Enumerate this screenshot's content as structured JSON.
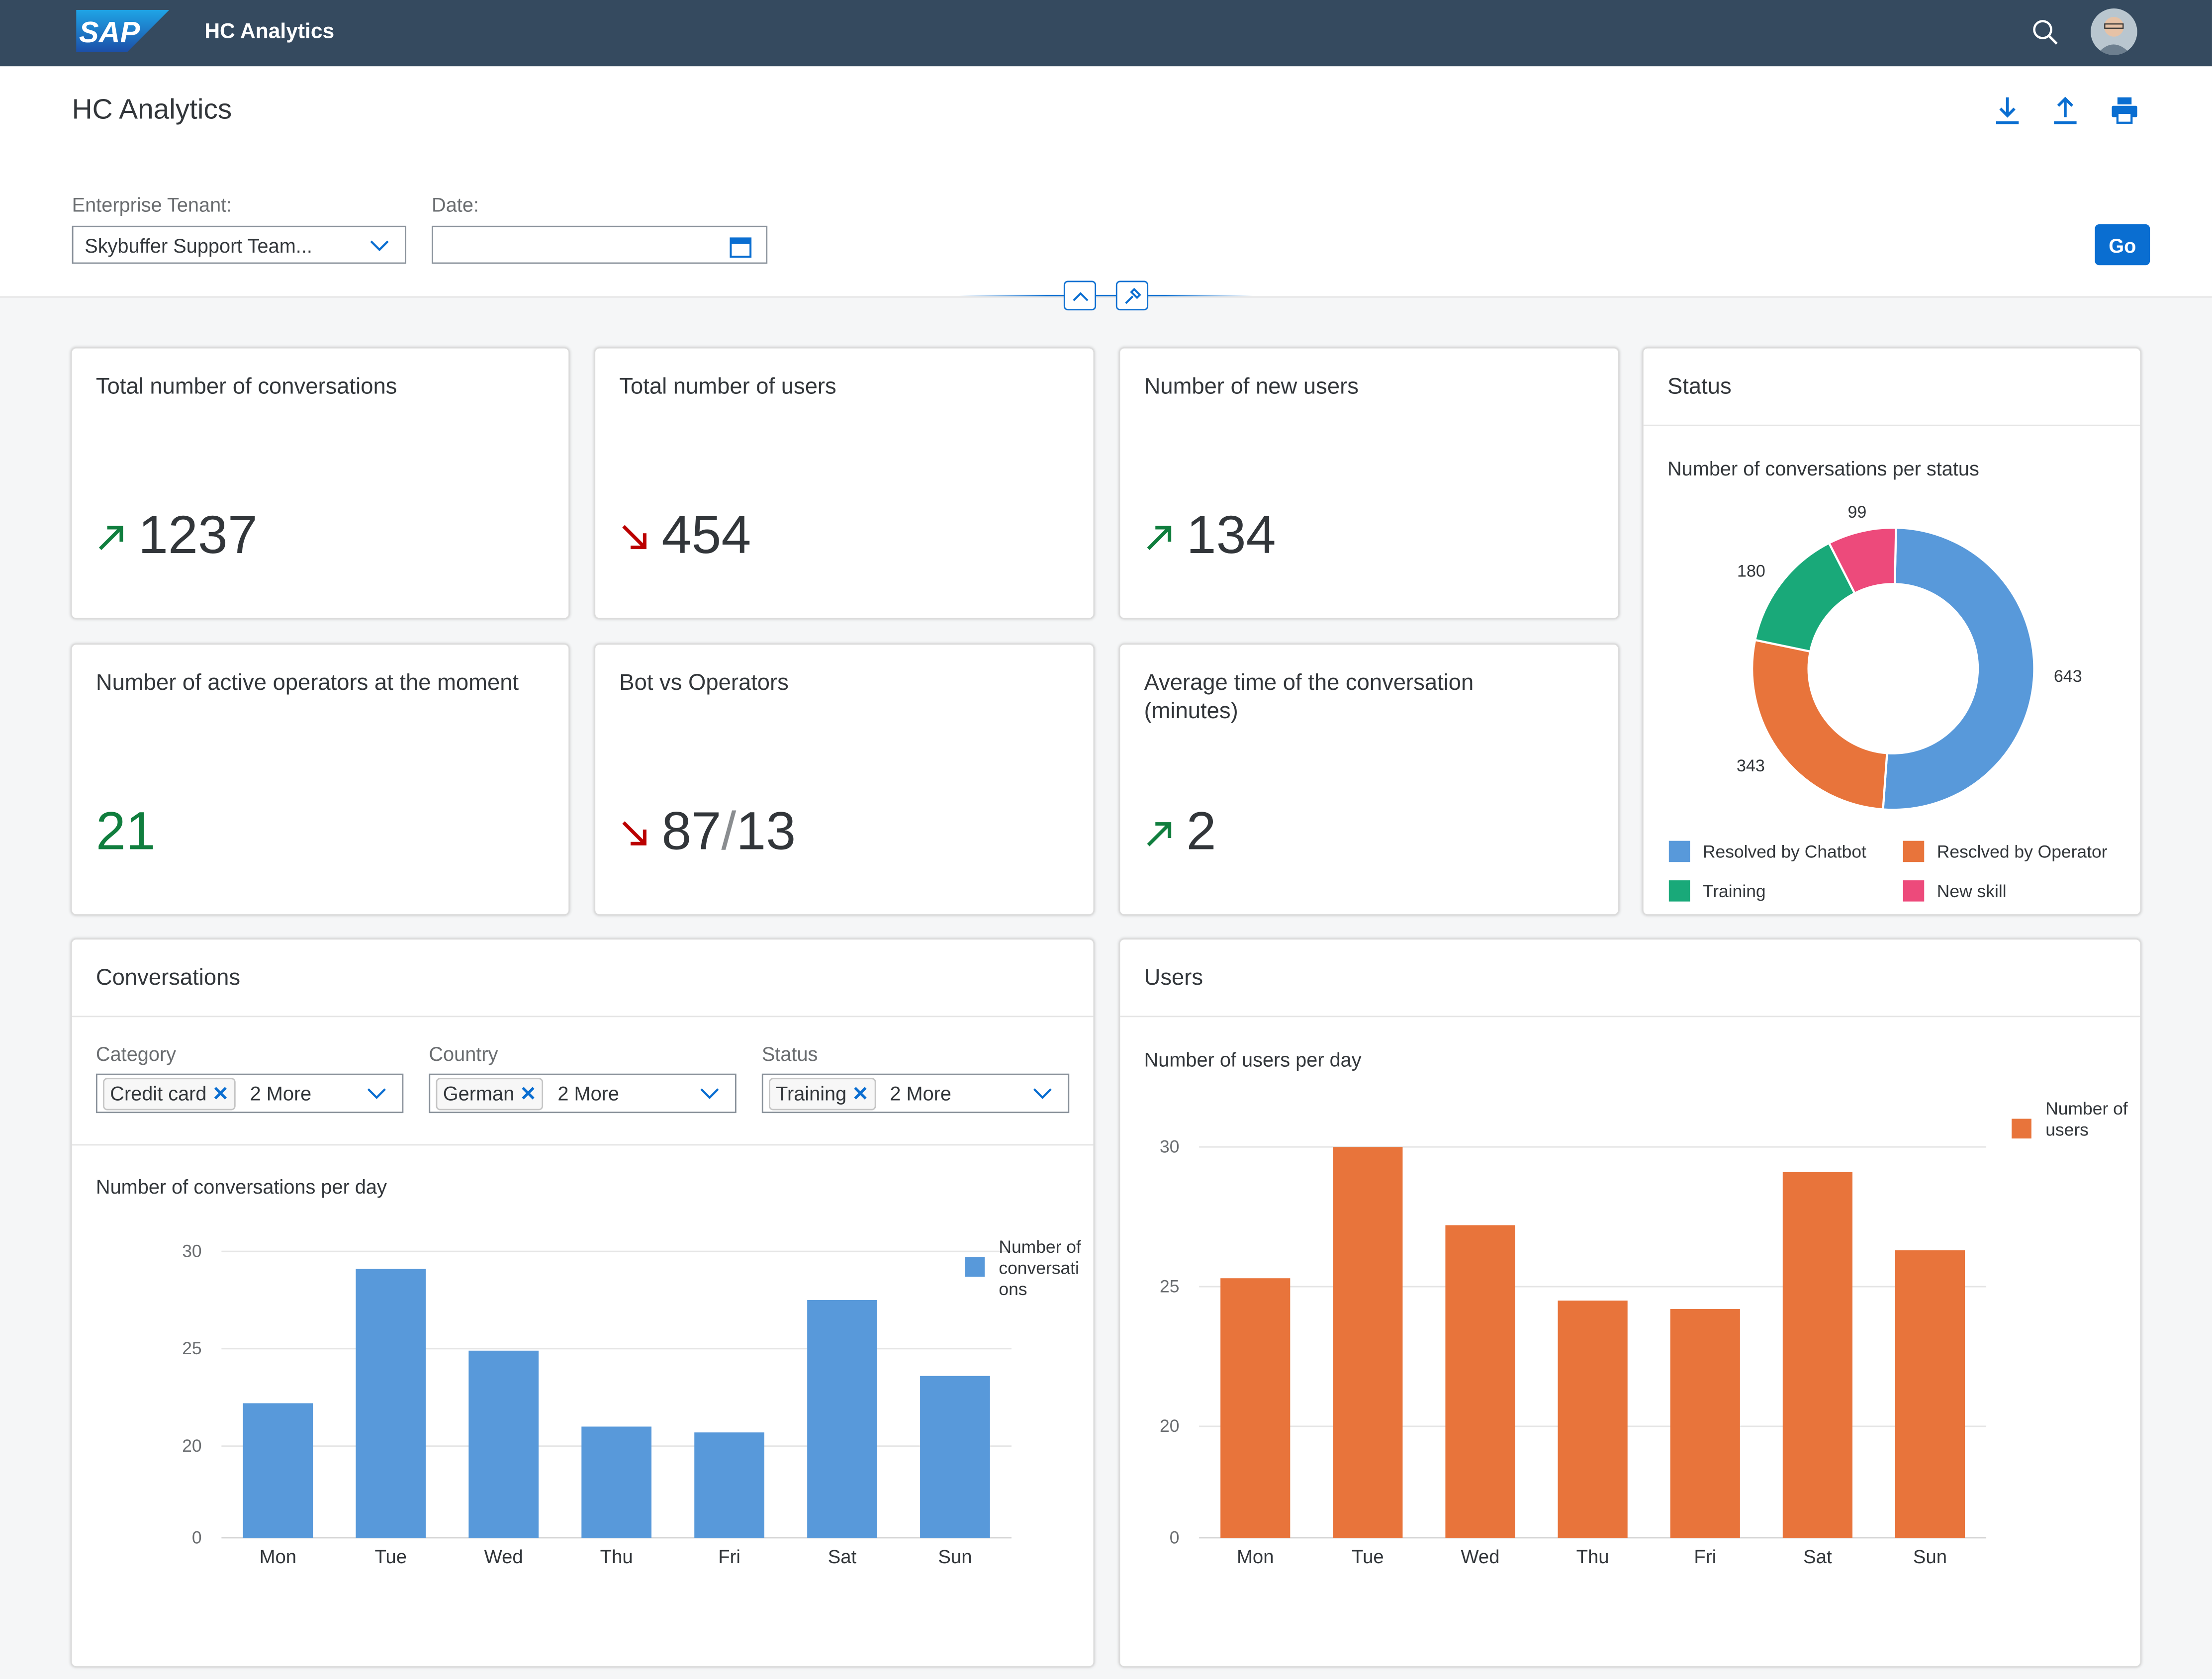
{
  "shell": {
    "logo_text": "SAP",
    "title": "HC Analytics",
    "icons": [
      "search-icon",
      "user-avatar"
    ]
  },
  "header": {
    "title": "HC Analytics",
    "actions": [
      "download-icon",
      "upload-icon",
      "print-icon"
    ],
    "filters": {
      "tenant_label": "Enterprise Tenant:",
      "tenant_value": "Skybuffer Support Team...",
      "date_label": "Date:",
      "date_value": ""
    },
    "go_label": "Go"
  },
  "kpis": [
    {
      "title": "Total number of conversations",
      "value": "1237",
      "trend": "up"
    },
    {
      "title": "Total number of users",
      "value": "454",
      "trend": "down"
    },
    {
      "title": "Number of new users",
      "value": "134",
      "trend": "up"
    },
    {
      "title": "Number of active operators at the moment",
      "value": "21",
      "trend": "none"
    },
    {
      "title": "Bot vs Operators",
      "value_a": "87",
      "value_sep": "/",
      "value_b": "13",
      "trend": "down"
    },
    {
      "title": "Average time of the conversation (minutes)",
      "value": "2",
      "trend": "up"
    }
  ],
  "colors": {
    "up": "#107e3e",
    "down": "#bb0000",
    "blue": "#5899da",
    "orange": "#e8743b",
    "green": "#19a979",
    "pink": "#ed4a7b",
    "accent": "#0a6ed1"
  },
  "status_card": {
    "title": "Status"
  },
  "conversations_card": {
    "title": "Conversations",
    "filters": [
      {
        "label": "Category",
        "token": "Credit card",
        "more": "2 More"
      },
      {
        "label": "Country",
        "token": "German",
        "more": "2 More"
      },
      {
        "label": "Status",
        "token": "Training",
        "more": "2 More"
      }
    ]
  },
  "users_card": {
    "title": "Users"
  },
  "chart_data": [
    {
      "type": "pie",
      "donut": true,
      "title": "Number of conversations per status",
      "categories": [
        "Resolved by Chatbot",
        "Resclved by Operator",
        "Training",
        "New skill"
      ],
      "values": [
        643,
        343,
        180,
        99
      ],
      "labels": [
        "643",
        "343",
        "180",
        "99"
      ],
      "legend": "bottom"
    },
    {
      "type": "bar",
      "title": "Number of conversations per day",
      "categories": [
        "Mon",
        "Tue",
        "Wed",
        "Thu",
        "Fri",
        "Sat",
        "Sun"
      ],
      "series": [
        {
          "name": "Number of conversati ons",
          "values": [
            22.2,
            29.1,
            24.9,
            21.0,
            20.7,
            27.5,
            23.6
          ]
        }
      ],
      "yticks": [
        "0",
        "20",
        "25",
        "30"
      ],
      "ylim": [
        0,
        30
      ],
      "axis_break": true,
      "grid": true,
      "legend": "right"
    },
    {
      "type": "bar",
      "title": "Number of users per day",
      "categories": [
        "Mon",
        "Tue",
        "Wed",
        "Thu",
        "Fri",
        "Sat",
        "Sun"
      ],
      "series": [
        {
          "name": "Number of users",
          "values": [
            25.3,
            30.2,
            27.2,
            24.5,
            24.2,
            29.1,
            26.3
          ]
        }
      ],
      "yticks": [
        "0",
        "20",
        "25",
        "30"
      ],
      "ylim": [
        0,
        30
      ],
      "axis_break": true,
      "grid": true,
      "legend": "right"
    }
  ]
}
